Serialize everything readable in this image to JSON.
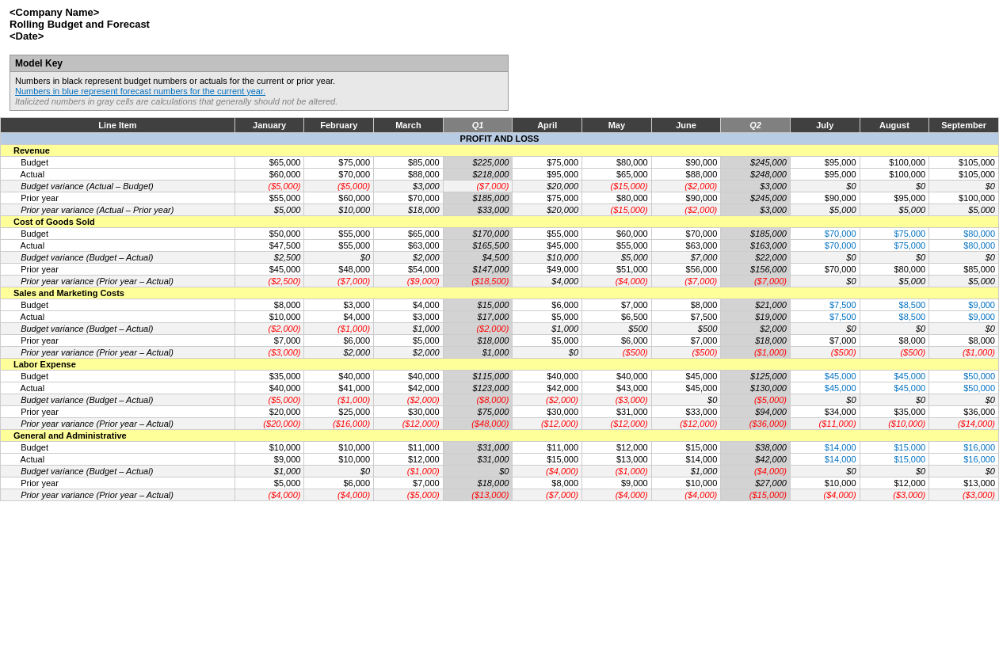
{
  "header": {
    "company": "<Company Name>",
    "title": "Rolling Budget and Forecast",
    "date": "<Date>"
  },
  "modelKey": {
    "title": "Model Key",
    "line1": "Numbers in black represent budget numbers or actuals for the current or prior year.",
    "line2": "Numbers in blue represent forecast numbers for the current year.",
    "line3": "Italicized numbers in gray cells are calculations that generally should not be altered."
  },
  "columns": {
    "lineItem": "Line Item",
    "months": [
      "January",
      "February",
      "March",
      "Q1",
      "April",
      "May",
      "June",
      "Q2",
      "July",
      "August",
      "September"
    ]
  },
  "sections": {
    "pnl": "PROFIT AND LOSS",
    "revenue": "Revenue",
    "cogs": "Cost of Goods Sold",
    "sales": "Sales and Marketing Costs",
    "labor": "Labor Expense",
    "ga": "General and Administrative"
  },
  "rows": {
    "revenue": {
      "budget": [
        "$65,000",
        "$75,000",
        "$85,000",
        "$225,000",
        "$75,000",
        "$80,000",
        "$90,000",
        "$245,000",
        "$95,000",
        "$100,000",
        "$105,000"
      ],
      "actual": [
        "$60,000",
        "$70,000",
        "$88,000",
        "$218,000",
        "$95,000",
        "$65,000",
        "$88,000",
        "$248,000",
        "$95,000",
        "$100,000",
        "$105,000"
      ],
      "variance_ba": [
        "($5,000)",
        "($5,000)",
        "$3,000",
        "($7,000)",
        "$20,000",
        "($15,000)",
        "($2,000)",
        "$3,000",
        "$0",
        "$0",
        "$0"
      ],
      "prioryear": [
        "$55,000",
        "$60,000",
        "$70,000",
        "$185,000",
        "$75,000",
        "$80,000",
        "$90,000",
        "$245,000",
        "$90,000",
        "$95,000",
        "$100,000"
      ],
      "variance_pya": [
        "$5,000",
        "$10,000",
        "$18,000",
        "$33,000",
        "$20,000",
        "($15,000)",
        "($2,000)",
        "$3,000",
        "$5,000",
        "$5,000",
        "$5,000"
      ]
    },
    "cogs": {
      "budget": [
        "$50,000",
        "$55,000",
        "$65,000",
        "$170,000",
        "$55,000",
        "$60,000",
        "$70,000",
        "$185,000",
        "$70,000",
        "$75,000",
        "$80,000"
      ],
      "actual": [
        "$47,500",
        "$55,000",
        "$63,000",
        "$165,500",
        "$45,000",
        "$55,000",
        "$63,000",
        "$163,000",
        "$70,000",
        "$75,000",
        "$80,000"
      ],
      "variance_ba": [
        "$2,500",
        "$0",
        "$2,000",
        "$4,500",
        "$10,000",
        "$5,000",
        "$7,000",
        "$22,000",
        "$0",
        "$0",
        "$0"
      ],
      "prioryear": [
        "$45,000",
        "$48,000",
        "$54,000",
        "$147,000",
        "$49,000",
        "$51,000",
        "$56,000",
        "$156,000",
        "$70,000",
        "$80,000",
        "$85,000"
      ],
      "variance_pya": [
        "($2,500)",
        "($7,000)",
        "($9,000)",
        "($18,500)",
        "$4,000",
        "($4,000)",
        "($7,000)",
        "($7,000)",
        "$0",
        "$5,000",
        "$5,000"
      ]
    },
    "sales": {
      "budget": [
        "$8,000",
        "$3,000",
        "$4,000",
        "$15,000",
        "$6,000",
        "$7,000",
        "$8,000",
        "$21,000",
        "$7,500",
        "$8,500",
        "$9,000"
      ],
      "actual": [
        "$10,000",
        "$4,000",
        "$3,000",
        "$17,000",
        "$5,000",
        "$6,500",
        "$7,500",
        "$19,000",
        "$7,500",
        "$8,500",
        "$9,000"
      ],
      "variance_ba": [
        "($2,000)",
        "($1,000)",
        "$1,000",
        "($2,000)",
        "$1,000",
        "$500",
        "$500",
        "$2,000",
        "$0",
        "$0",
        "$0"
      ],
      "prioryear": [
        "$7,000",
        "$6,000",
        "$5,000",
        "$18,000",
        "$5,000",
        "$6,000",
        "$7,000",
        "$18,000",
        "$7,000",
        "$8,000",
        "$8,000"
      ],
      "variance_pya": [
        "($3,000)",
        "$2,000",
        "$2,000",
        "$1,000",
        "$0",
        "($500)",
        "($500)",
        "($1,000)",
        "($500)",
        "($500)",
        "($1,000)"
      ]
    },
    "labor": {
      "budget": [
        "$35,000",
        "$40,000",
        "$40,000",
        "$115,000",
        "$40,000",
        "$40,000",
        "$45,000",
        "$125,000",
        "$45,000",
        "$45,000",
        "$50,000"
      ],
      "actual": [
        "$40,000",
        "$41,000",
        "$42,000",
        "$123,000",
        "$42,000",
        "$43,000",
        "$45,000",
        "$130,000",
        "$45,000",
        "$45,000",
        "$50,000"
      ],
      "variance_ba": [
        "($5,000)",
        "($1,000)",
        "($2,000)",
        "($8,000)",
        "($2,000)",
        "($3,000)",
        "$0",
        "($5,000)",
        "$0",
        "$0",
        "$0"
      ],
      "prioryear": [
        "$20,000",
        "$25,000",
        "$30,000",
        "$75,000",
        "$30,000",
        "$31,000",
        "$33,000",
        "$94,000",
        "$34,000",
        "$35,000",
        "$36,000"
      ],
      "variance_pya": [
        "($20,000)",
        "($16,000)",
        "($12,000)",
        "($48,000)",
        "($12,000)",
        "($12,000)",
        "($12,000)",
        "($36,000)",
        "($11,000)",
        "($10,000)",
        "($14,000)"
      ]
    },
    "ga": {
      "budget": [
        "$10,000",
        "$10,000",
        "$11,000",
        "$31,000",
        "$11,000",
        "$12,000",
        "$15,000",
        "$38,000",
        "$14,000",
        "$15,000",
        "$16,000"
      ],
      "actual": [
        "$9,000",
        "$10,000",
        "$12,000",
        "$31,000",
        "$15,000",
        "$13,000",
        "$14,000",
        "$42,000",
        "$14,000",
        "$15,000",
        "$16,000"
      ],
      "variance_ba": [
        "$1,000",
        "$0",
        "($1,000)",
        "$0",
        "($4,000)",
        "($1,000)",
        "$1,000",
        "($4,000)",
        "$0",
        "$0",
        "$0"
      ],
      "prioryear": [
        "$5,000",
        "$6,000",
        "$7,000",
        "$18,000",
        "$8,000",
        "$9,000",
        "$10,000",
        "$27,000",
        "$10,000",
        "$12,000",
        "$13,000"
      ],
      "variance_pya": [
        "($4,000)",
        "($4,000)",
        "($5,000)",
        "($13,000)",
        "($7,000)",
        "($4,000)",
        "($4,000)",
        "($15,000)",
        "($4,000)",
        "($3,000)",
        "($3,000)"
      ]
    }
  }
}
